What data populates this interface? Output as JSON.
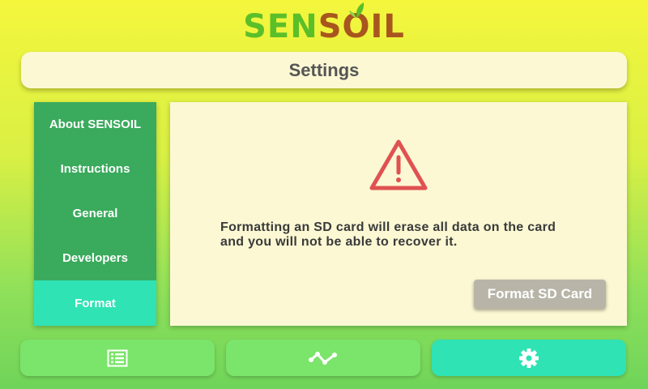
{
  "logo": {
    "part1": "SEN",
    "part2": "SOIL"
  },
  "header": {
    "title": "Settings"
  },
  "sidebar": {
    "items": [
      {
        "label": "About SENSOIL"
      },
      {
        "label": "Instructions"
      },
      {
        "label": "General"
      },
      {
        "label": "Developers"
      },
      {
        "label": "Format"
      }
    ],
    "active": "Format"
  },
  "main": {
    "warning_icon": "warning-triangle-icon",
    "warning_line1": "Formatting an SD card will erase all data on the card",
    "warning_line2": "and you will not be able to recover it.",
    "format_button": "Format SD Card"
  },
  "bottom_nav": [
    {
      "icon": "list-icon"
    },
    {
      "icon": "graph-icon"
    },
    {
      "icon": "gear-icon",
      "active": true
    }
  ],
  "colors": {
    "sidebar_bg": "#3aaa5c",
    "active_accent": "#2fe3b4",
    "nav_bg": "#7be46a",
    "panel_bg": "#fbf8d3",
    "warning_red": "#e05252",
    "button_disabled": "#b8b5a8"
  }
}
